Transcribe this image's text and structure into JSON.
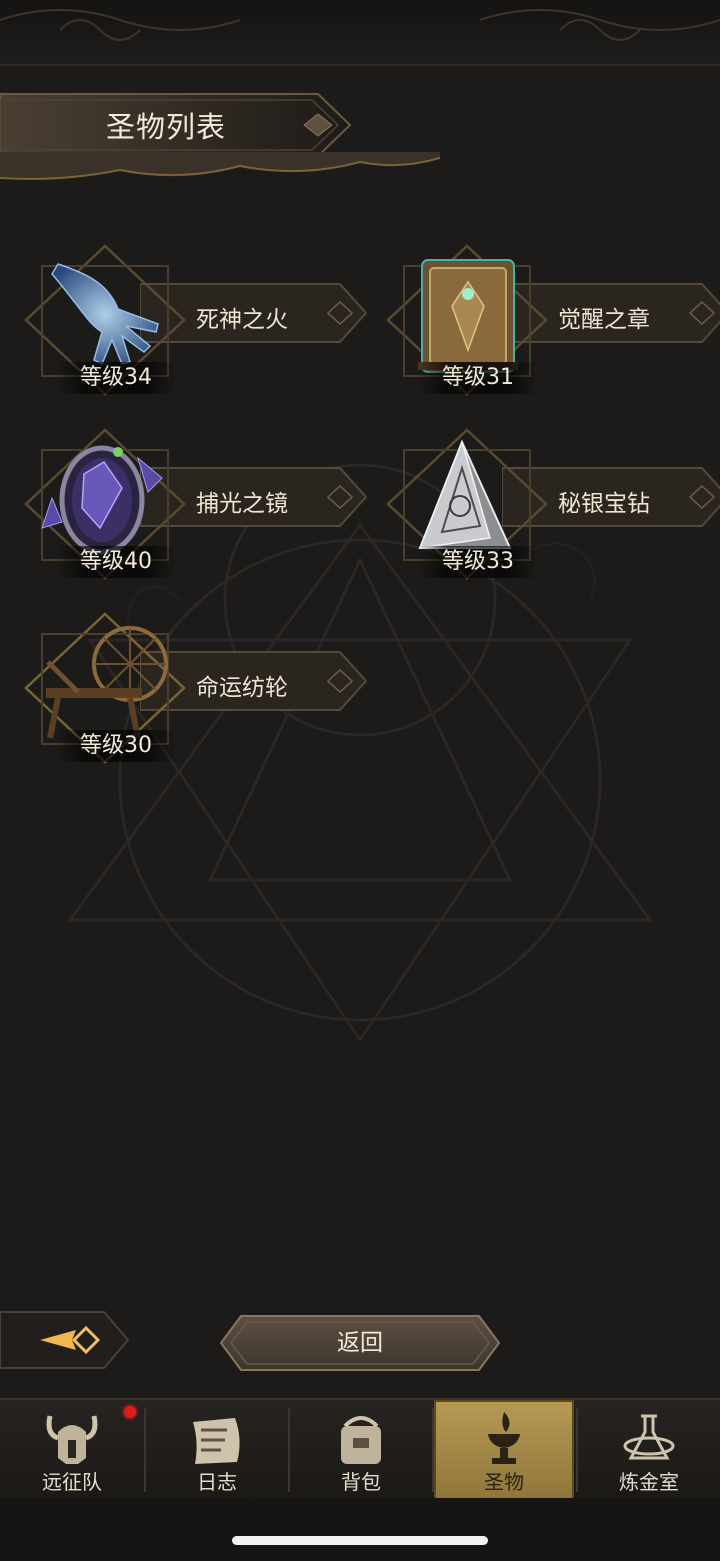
{
  "header": {
    "title": "圣物列表"
  },
  "relics": [
    {
      "name": "死神之火",
      "level": "等级34",
      "icon": "spectral-hand-icon"
    },
    {
      "name": "觉醒之章",
      "level": "等级31",
      "icon": "ornate-book-icon"
    },
    {
      "name": "捕光之镜",
      "level": "等级40",
      "icon": "crystal-mirror-icon"
    },
    {
      "name": "秘银宝钻",
      "level": "等级33",
      "icon": "silver-tetrahedron-icon"
    },
    {
      "name": "命运纺轮",
      "level": "等级30",
      "icon": "spinning-wheel-icon"
    }
  ],
  "footer": {
    "back_label": "返回"
  },
  "tabs": [
    {
      "label": "远征队",
      "icon": "horned-helmet-icon",
      "notification": true
    },
    {
      "label": "日志",
      "icon": "scroll-icon"
    },
    {
      "label": "背包",
      "icon": "satchel-icon"
    },
    {
      "label": "圣物",
      "icon": "brazier-icon",
      "active": true
    },
    {
      "label": "炼金室",
      "icon": "alchemy-icon"
    }
  ],
  "colors": {
    "background": "#1c1b1a",
    "accent_gold": "#b69b56",
    "notification": "#e11b1b"
  }
}
